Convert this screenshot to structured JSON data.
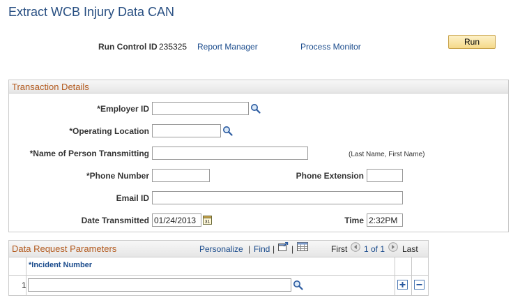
{
  "page": {
    "title": "Extract WCB Injury Data CAN"
  },
  "toolbar": {
    "run_control_label": "Run Control ID",
    "run_control_value": "235325",
    "report_manager": "Report Manager",
    "process_monitor": "Process Monitor",
    "run_label": "Run"
  },
  "transaction": {
    "header": "Transaction Details",
    "employer_id_label": "*Employer ID",
    "employer_id_value": "",
    "operating_location_label": "*Operating Location",
    "operating_location_value": "",
    "person_label": "*Name of Person Transmitting",
    "person_value": "",
    "person_note": "(Last Name, First Name)",
    "phone_label": "*Phone Number",
    "phone_value": "",
    "phone_ext_label": "Phone Extension",
    "phone_ext_value": "",
    "email_label": "Email ID",
    "email_value": "",
    "date_label": "Date Transmitted",
    "date_value": "01/24/2013",
    "time_label": "Time",
    "time_value": "2:32PM"
  },
  "params": {
    "header": "Data Request Parameters",
    "personalize": "Personalize",
    "separator": "|",
    "find": "Find",
    "first": "First",
    "range": "1 of 1",
    "last": "Last",
    "column_header": "*Incident Number",
    "rows": [
      {
        "num": "1",
        "incident": ""
      }
    ]
  },
  "icons": {
    "lookup": "magnifier-icon",
    "calendar": "calendar-icon",
    "view_all": "new-window-icon",
    "download": "spreadsheet-icon",
    "prev": "left-arrow-icon",
    "next": "right-arrow-icon",
    "add": "plus-icon",
    "delete": "minus-icon"
  },
  "colors": {
    "title": "#284f82",
    "link": "#1a4b8c",
    "group_header": "#b35a1e",
    "button": "#f5d98a"
  }
}
